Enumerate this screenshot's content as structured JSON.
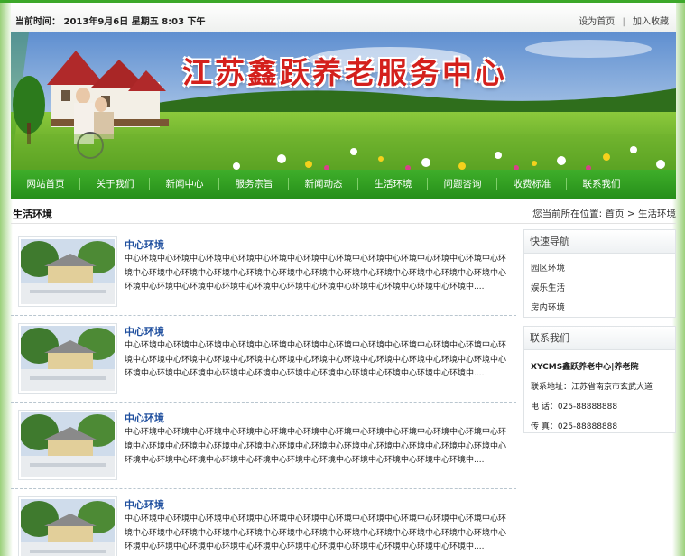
{
  "topbar": {
    "time_label": "当前时间：",
    "time_value": "2013年9月6日  星期五  8:03  下午",
    "set_home": "设为首页",
    "separator": "|",
    "bookmark": "加入收藏"
  },
  "banner": {
    "title": "江苏鑫跃养老服务中心"
  },
  "nav": {
    "items": [
      "网站首页",
      "关于我们",
      "新闻中心",
      "服务宗旨",
      "新闻动态",
      "生活环境",
      "问题咨询",
      "收费标准",
      "联系我们"
    ]
  },
  "crumb": {
    "section": "生活环境",
    "prefix": "您当前所在位置:",
    "home": "首页",
    "arrow": ">",
    "current": "生活环境"
  },
  "entries": [
    {
      "title": "中心环境",
      "desc": "中心环境中心环境中心环境中心环境中心环境中心环境中心环境中心环境中心环境中心环境中心环境中心环境中心环境中心环境中心环境中心环境中心环境中心环境中心环境中心环境中心环境中心环境中心环境中心环境中心环境中心环境中心环境中心环境中心环境中心环境中心环境中心环境中心环境中心环境中...."
    },
    {
      "title": "中心环境",
      "desc": "中心环境中心环境中心环境中心环境中心环境中心环境中心环境中心环境中心环境中心环境中心环境中心环境中心环境中心环境中心环境中心环境中心环境中心环境中心环境中心环境中心环境中心环境中心环境中心环境中心环境中心环境中心环境中心环境中心环境中心环境中心环境中心环境中心环境中心环境中...."
    },
    {
      "title": "中心环境",
      "desc": "中心环境中心环境中心环境中心环境中心环境中心环境中心环境中心环境中心环境中心环境中心环境中心环境中心环境中心环境中心环境中心环境中心环境中心环境中心环境中心环境中心环境中心环境中心环境中心环境中心环境中心环境中心环境中心环境中心环境中心环境中心环境中心环境中心环境中心环境中...."
    },
    {
      "title": "中心环境",
      "desc": "中心环境中心环境中心环境中心环境中心环境中心环境中心环境中心环境中心环境中心环境中心环境中心环境中心环境中心环境中心环境中心环境中心环境中心环境中心环境中心环境中心环境中心环境中心环境中心环境中心环境中心环境中心环境中心环境中心环境中心环境中心环境中心环境中心环境中心环境中...."
    }
  ],
  "sidebar": {
    "quick_nav_title": "快速导航",
    "quick_nav_items": [
      "园区环境",
      "娱乐生活",
      "房内环境"
    ],
    "contact_title": "联系我们",
    "contact_name": "XYCMS鑫跃养老中心|养老院",
    "contact_address": "联系地址：江苏省南京市玄武大道",
    "contact_phone": "电  话：025-88888888",
    "contact_fax": "传  真：025-88888888"
  },
  "colors": {
    "nav_green": "#2f9e22",
    "title_red": "#d4201c",
    "link_blue": "#1f4f9e"
  }
}
